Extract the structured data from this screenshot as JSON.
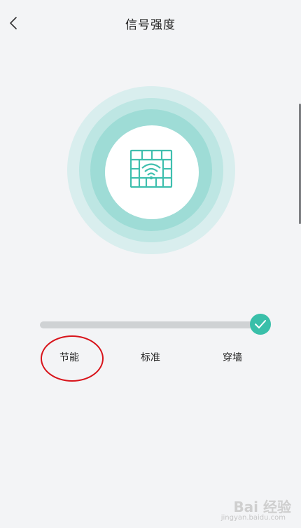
{
  "header": {
    "title": "信号强度"
  },
  "signal": {
    "level": "节能",
    "level_index": 0
  },
  "levels": [
    {
      "label": "节能"
    },
    {
      "label": "标准"
    },
    {
      "label": "穿墙"
    }
  ],
  "colors": {
    "accent": "#39bfa9",
    "annotation": "#d8141b",
    "track": "#cfd2d4",
    "background": "#f3f4f6"
  },
  "icons": {
    "back": "chevron-left-icon",
    "center": "wifi-wall-icon",
    "thumb": "checkmark-icon"
  },
  "watermark": {
    "text": "Bai 经验",
    "sub": "jingyan.baidu.com"
  }
}
